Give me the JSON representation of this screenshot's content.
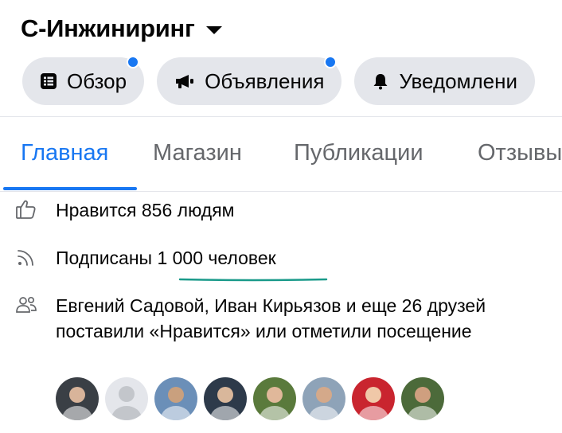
{
  "page": {
    "title": "С-Инжиниринг"
  },
  "chips": [
    {
      "label": "Обзор",
      "icon": "news-feed-icon",
      "has_notification": true
    },
    {
      "label": "Объявления",
      "icon": "megaphone-icon",
      "has_notification": true
    },
    {
      "label": "Уведомлени",
      "icon": "bell-icon",
      "has_notification": false
    }
  ],
  "tabs": [
    {
      "label": "Главная",
      "active": true
    },
    {
      "label": "Магазин",
      "active": false
    },
    {
      "label": "Публикации",
      "active": false
    },
    {
      "label": "Отзывы",
      "active": false
    }
  ],
  "info": {
    "likes": "Нравится 856 людям",
    "followers": "Подписаны 1 000 человек",
    "friends": "Евгений Садовой, Иван Кирьязов и еще 26 друзей поставили «Нравится» или отметили посещение"
  },
  "friends_avatars": [
    {
      "kind": "photo",
      "bg": "#3a3f45",
      "skin": "#d8b49a"
    },
    {
      "kind": "placeholder",
      "bg": "#e4e6eb",
      "skin": "#c3c6cb"
    },
    {
      "kind": "photo",
      "bg": "#6b8fb8",
      "skin": "#c9a07e"
    },
    {
      "kind": "photo",
      "bg": "#2d3a4a",
      "skin": "#d9b79b"
    },
    {
      "kind": "photo",
      "bg": "#5a7a3c",
      "skin": "#e0b89a"
    },
    {
      "kind": "photo",
      "bg": "#8ea3b8",
      "skin": "#d4a98a"
    },
    {
      "kind": "photo",
      "bg": "#c9252f",
      "skin": "#f0c8a8"
    },
    {
      "kind": "photo",
      "bg": "#4c6a3a",
      "skin": "#cf9f7f"
    }
  ],
  "colors": {
    "accent": "#1877f2",
    "chip_bg": "#e4e6eb",
    "muted": "#65676b",
    "annotation": "#1a9a8a"
  }
}
